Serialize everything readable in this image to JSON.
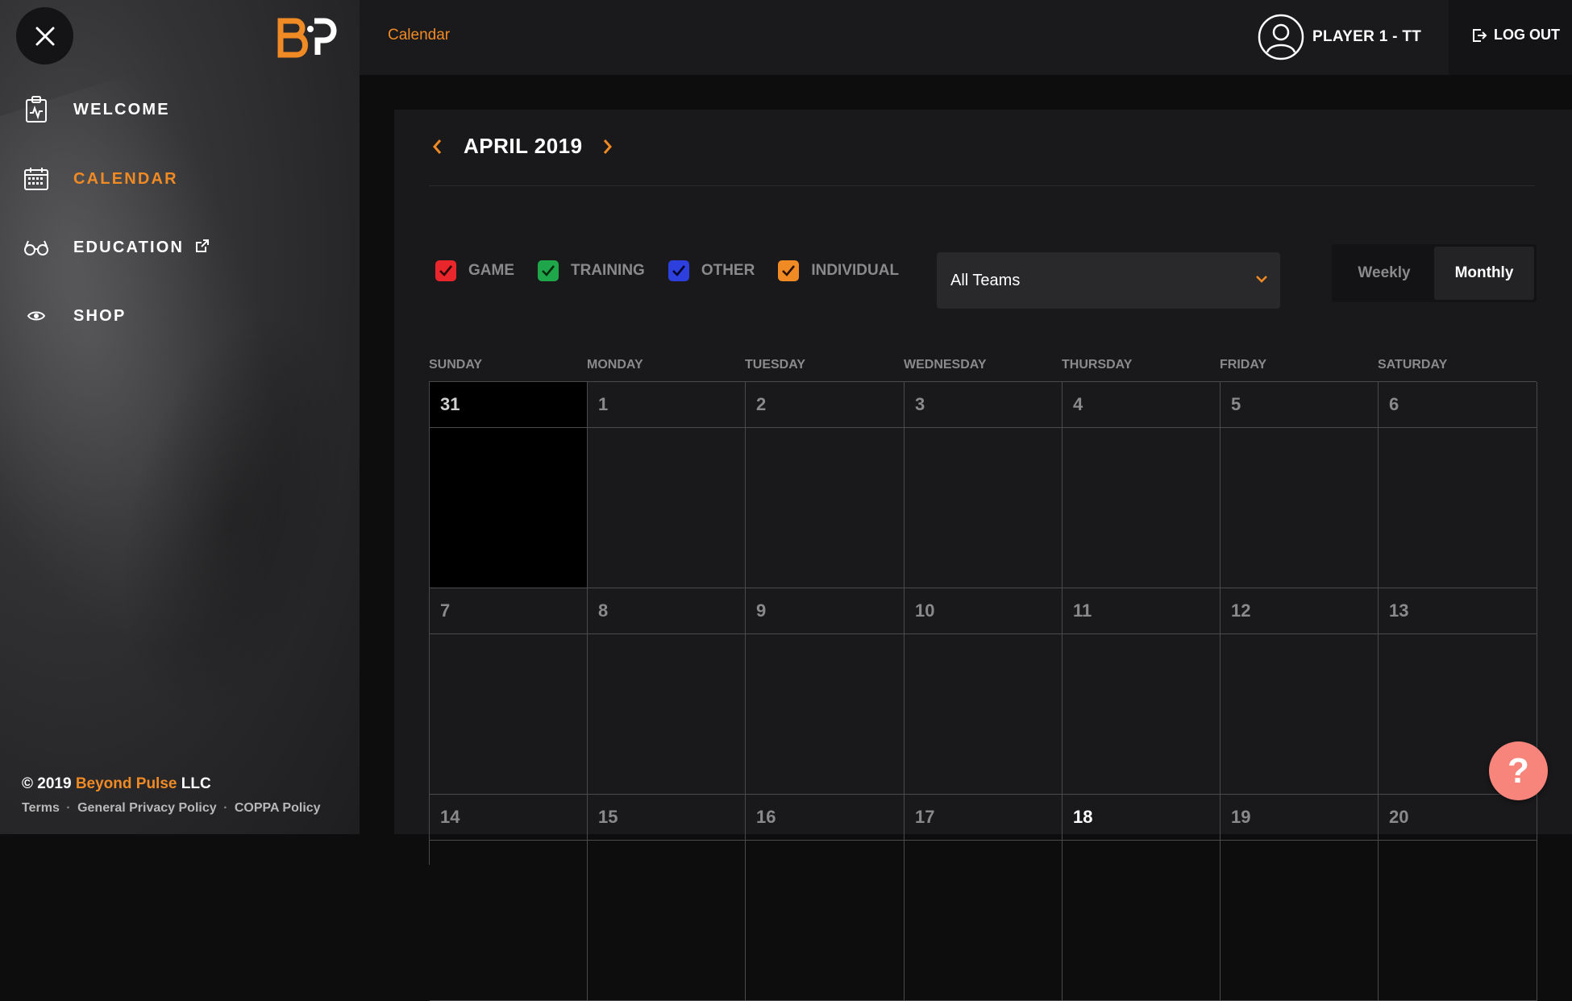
{
  "brand": {
    "logo_text": "BP",
    "accent": "#f08a24"
  },
  "sidebar": {
    "items": [
      {
        "label": "WELCOME",
        "icon": "clipboard-pulse-icon",
        "active": false
      },
      {
        "label": "CALENDAR",
        "icon": "calendar-icon",
        "active": true
      },
      {
        "label": "EDUCATION",
        "icon": "glasses-icon",
        "active": false,
        "external": true
      },
      {
        "label": "SHOP",
        "icon": "eye-icon",
        "active": false
      }
    ],
    "footer": {
      "copyright_prefix": "© 2019",
      "company": "Beyond Pulse",
      "copyright_suffix": "LLC",
      "links": [
        "Terms",
        "General Privacy Policy",
        "COPPA Policy"
      ],
      "separator": "·"
    }
  },
  "header": {
    "breadcrumb": "Calendar",
    "user_name": "PLAYER 1 - TT",
    "logout_label": "LOG OUT"
  },
  "calendar": {
    "month_label": "APRIL 2019",
    "filters": [
      {
        "label": "GAME",
        "color": "#e8262c",
        "checked": true
      },
      {
        "label": "TRAINING",
        "color": "#1fa64a",
        "checked": true
      },
      {
        "label": "OTHER",
        "color": "#2d3fdc",
        "checked": true
      },
      {
        "label": "INDIVIDUAL",
        "color": "#f08a24",
        "checked": true
      }
    ],
    "team_select": {
      "value": "All Teams"
    },
    "views": [
      {
        "label": "Weekly",
        "active": false
      },
      {
        "label": "Monthly",
        "active": true
      }
    ],
    "weekdays": [
      "SUNDAY",
      "MONDAY",
      "TUESDAY",
      "WEDNESDAY",
      "THURSDAY",
      "FRIDAY",
      "SATURDAY"
    ],
    "weeks": [
      [
        "31",
        "1",
        "2",
        "3",
        "4",
        "5",
        "6"
      ],
      [
        "7",
        "8",
        "9",
        "10",
        "11",
        "12",
        "13"
      ],
      [
        "14",
        "15",
        "16",
        "17",
        "18",
        "19",
        "20"
      ]
    ],
    "today": "18"
  },
  "help": {
    "label": "?"
  }
}
